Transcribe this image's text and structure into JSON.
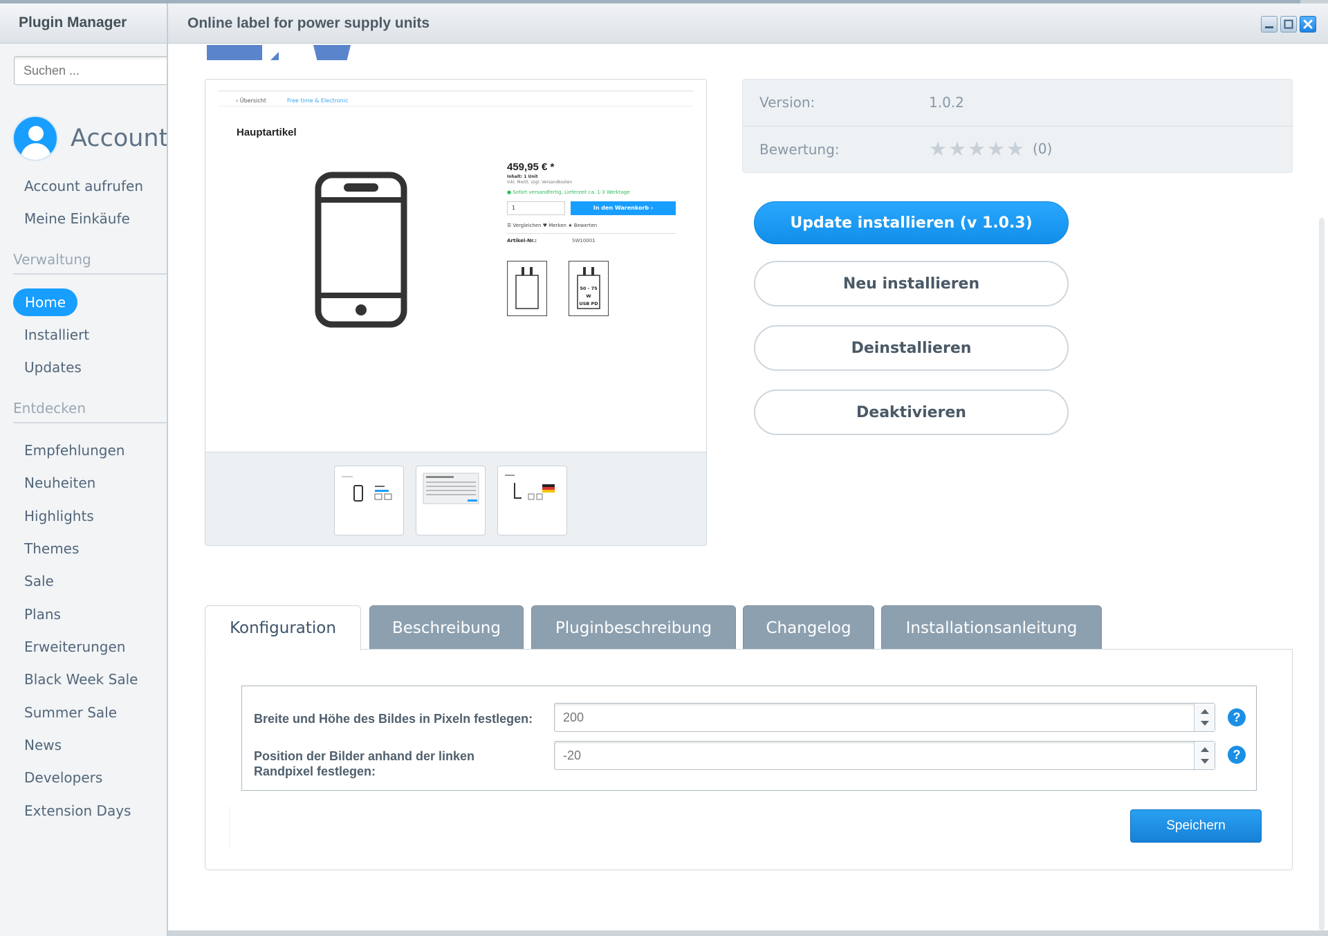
{
  "sidebar": {
    "title": "Plugin Manager",
    "search_placeholder": "Suchen ...",
    "account_title": "Account",
    "account_links": [
      "Account aufrufen",
      "Meine Einkäufe"
    ],
    "section_verwaltung": "Verwaltung",
    "verwaltung_items": [
      "Home",
      "Installiert",
      "Updates"
    ],
    "section_entdecken": "Entdecken",
    "entdecken_items": [
      "Empfehlungen",
      "Neuheiten",
      "Highlights",
      "Themes",
      "Sale",
      "Plans",
      "Erweiterungen",
      "Black Week Sale",
      "Summer Sale",
      "News",
      "Developers",
      "Extension Days"
    ]
  },
  "modal": {
    "title": "Online label for power supply units"
  },
  "preview": {
    "breadcrumb_back": "‹  Übersicht",
    "breadcrumb_category": "Free time & Electronic",
    "heading": "Hauptartikel",
    "price": "459,95 € *",
    "content_line": "Inhalt: 1 Unit",
    "tax_line": "inkl. MwSt. zzgl. Versandkosten",
    "delivery": "● Sofort versandfertig, Lieferzeit ca. 1-3 Werktage",
    "qty": "1",
    "cart_button": "In den Warenkorb  ›",
    "actions": "☰ Vergleichen    ♥ Merken    ★ Bewerten",
    "article_label": "Artikel-Nr.:",
    "article_value": "SW10001",
    "label_text_line1": "50 - 75",
    "label_text_line2": "W",
    "label_text_line3": "USB PD"
  },
  "info": {
    "version_label": "Version:",
    "version_value": "1.0.2",
    "rating_label": "Bewertung:",
    "rating_stars": 0,
    "rating_max": 5,
    "rating_count": "(0)"
  },
  "actions": {
    "update": "Update installieren (v 1.0.3)",
    "reinstall": "Neu installieren",
    "uninstall": "Deinstallieren",
    "deactivate": "Deaktivieren"
  },
  "tabs": [
    "Konfiguration",
    "Beschreibung",
    "Pluginbeschreibung",
    "Changelog",
    "Installationsanleitung"
  ],
  "active_tab": "Konfiguration",
  "config": {
    "field1_label": "Breite und Höhe des Bildes in Pixeln festlegen:",
    "field1_value": "200",
    "field2_label_line1": "Position der Bilder anhand der linken",
    "field2_label_line2": "Randpixel festlegen:",
    "field2_value": "-20",
    "help_symbol": "?",
    "save_label": "Speichern"
  },
  "colors": {
    "accent": "#189eff",
    "tab_inactive": "#8ca0b0",
    "sidebar_text": "#52667a"
  }
}
